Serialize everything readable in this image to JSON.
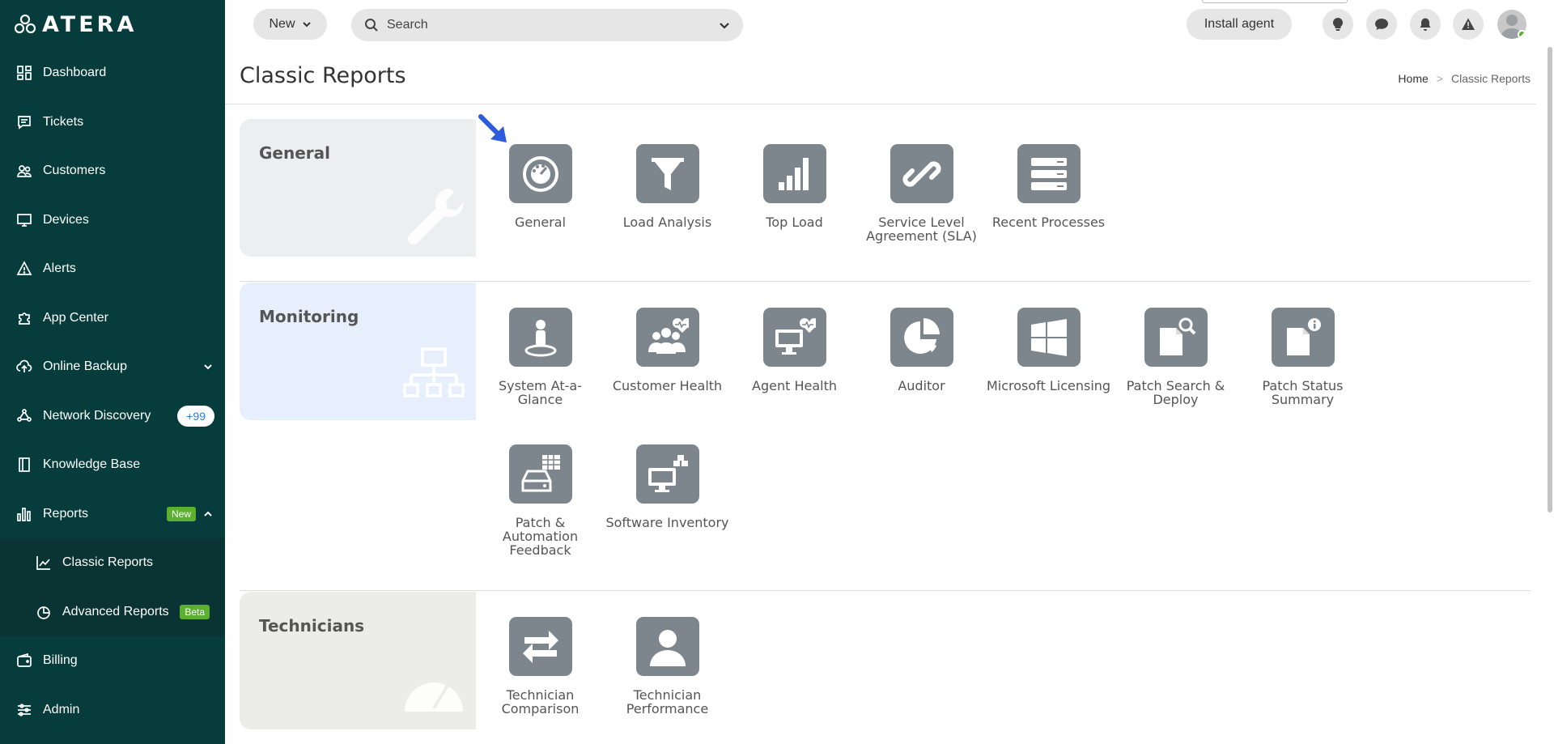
{
  "brand": {
    "name": "ATERA"
  },
  "sidebar": {
    "items": [
      {
        "label": "Dashboard",
        "icon": "dashboard-icon"
      },
      {
        "label": "Tickets",
        "icon": "tickets-icon"
      },
      {
        "label": "Customers",
        "icon": "customers-icon"
      },
      {
        "label": "Devices",
        "icon": "devices-icon"
      },
      {
        "label": "Alerts",
        "icon": "alert-icon"
      },
      {
        "label": "App Center",
        "icon": "puzzle-icon"
      },
      {
        "label": "Online Backup",
        "icon": "cloud-upload-icon"
      },
      {
        "label": "Network Discovery",
        "icon": "network-icon",
        "badge": "+99"
      },
      {
        "label": "Knowledge Base",
        "icon": "book-icon"
      },
      {
        "label": "Reports",
        "icon": "bar-chart-icon",
        "badge": "New"
      },
      {
        "label": "Classic Reports",
        "icon": "line-chart-icon"
      },
      {
        "label": "Advanced Reports",
        "icon": "pie-chart-icon",
        "badge": "Beta"
      },
      {
        "label": "Billing",
        "icon": "wallet-icon"
      },
      {
        "label": "Admin",
        "icon": "sliders-icon"
      }
    ]
  },
  "topbar": {
    "new_label": "New",
    "search_placeholder": "Search",
    "install_label": "Install agent"
  },
  "header": {
    "title": "Classic Reports",
    "breadcrumb": {
      "home": "Home",
      "separator": ">",
      "current": "Classic Reports"
    }
  },
  "sections": {
    "general": {
      "name": "General",
      "tiles": [
        {
          "label": "General",
          "icon": "speedometer-icon"
        },
        {
          "label": "Load Analysis",
          "icon": "funnel-icon"
        },
        {
          "label": "Top Load",
          "icon": "bars-icon"
        },
        {
          "label": "Service Level Agreement (SLA)",
          "icon": "link-icon"
        },
        {
          "label": "Recent Processes",
          "icon": "server-icon"
        }
      ]
    },
    "monitoring": {
      "name": "Monitoring",
      "tiles": [
        {
          "label": "System At-a-Glance",
          "icon": "person-pin-icon"
        },
        {
          "label": "Customer Health",
          "icon": "group-health-icon"
        },
        {
          "label": "Agent Health",
          "icon": "monitor-health-icon"
        },
        {
          "label": "Auditor",
          "icon": "pie-icon"
        },
        {
          "label": "Microsoft Licensing",
          "icon": "windows-icon"
        },
        {
          "label": "Patch Search & Deploy",
          "icon": "doc-search-icon"
        },
        {
          "label": "Patch Status Summary",
          "icon": "doc-info-icon"
        },
        {
          "label": "Patch & Automation Feedback",
          "icon": "drive-grid-icon"
        },
        {
          "label": "Software Inventory",
          "icon": "monitor-boxes-icon"
        }
      ]
    },
    "technicians": {
      "name": "Technicians",
      "tiles": [
        {
          "label": "Technician Comparison",
          "icon": "arrows-exchange-icon"
        },
        {
          "label": "Technician Performance",
          "icon": "person-icon"
        }
      ]
    }
  },
  "colors": {
    "sidebar_bg": "#063c3c",
    "tile_bg": "#7d868c",
    "accent_green": "#5cb030",
    "arrow_blue": "#2e5bdc"
  }
}
